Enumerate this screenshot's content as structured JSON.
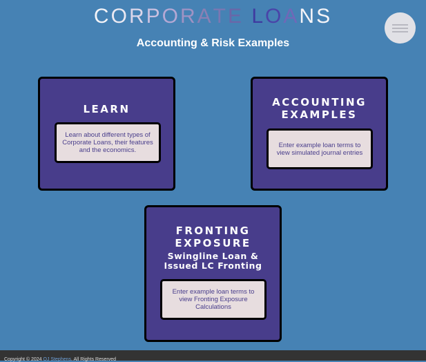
{
  "header": {
    "title_letters": [
      {
        "ch": "C",
        "color": "#f4f4f8"
      },
      {
        "ch": "O",
        "color": "#ebe9f2"
      },
      {
        "ch": "R",
        "color": "#dcd7ea"
      },
      {
        "ch": "P",
        "color": "#c9c0e0"
      },
      {
        "ch": "O",
        "color": "#b4a8d4"
      },
      {
        "ch": "R",
        "color": "#9f93c4"
      },
      {
        "ch": "A",
        "color": "#8a80b4"
      },
      {
        "ch": "T",
        "color": "#7b77b2"
      },
      {
        "ch": "E",
        "color": "#6b66a8"
      },
      {
        "ch": " ",
        "color": "#6b66a8"
      },
      {
        "ch": "L",
        "color": "#3f3aa0"
      },
      {
        "ch": "O",
        "color": "#4a44a8"
      },
      {
        "ch": "A",
        "color": "#7068b8"
      },
      {
        "ch": "N",
        "color": "#f4f4f8"
      },
      {
        "ch": "S",
        "color": "#f4f4f8"
      }
    ],
    "subtitle": "Accounting & Risk Examples"
  },
  "cards": {
    "learn": {
      "title": "LEARN",
      "description": "Learn about different types of Corporate Loans, their features and the economics."
    },
    "accounting": {
      "title_line1": "ACCOUNTING",
      "title_line2": "EXAMPLES",
      "description": "Enter example loan terms to view simulated journal entries"
    },
    "fronting": {
      "title_line1": "FRONTING",
      "title_line2": "EXPOSURE",
      "subtitle_line1": "Swingline Loan &",
      "subtitle_line2": "Issued LC Fronting",
      "description": "Enter example loan terms to view Fronting Exposure Calculations"
    }
  },
  "footer": {
    "prefix": "Copyright © 2024",
    "link": "OJ Stephens",
    "suffix": ". All Rights Reserved"
  },
  "colors": {
    "background": "#4682b4",
    "card": "#483d8b",
    "inner_box": "#e7dddf"
  }
}
